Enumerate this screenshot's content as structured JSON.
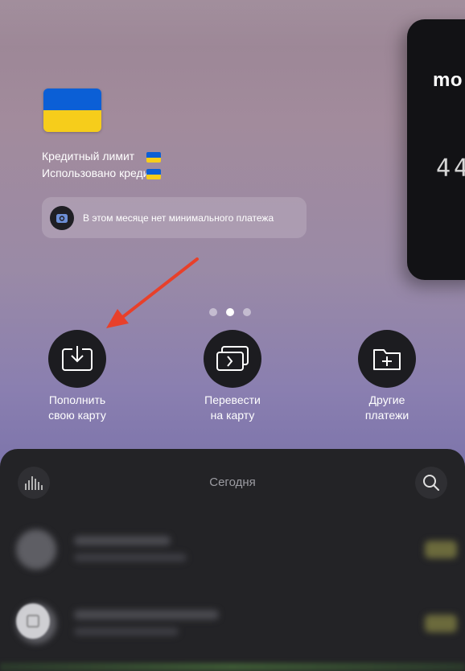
{
  "credit": {
    "limit_label": "Кредитный лимит",
    "used_label": "Использовано кредита"
  },
  "notice": {
    "text": "В этом месяце нет минимального платежа",
    "icon": "camera-icon"
  },
  "card": {
    "brand": "mo",
    "digits": "44"
  },
  "pager": {
    "count": 3,
    "active_index": 1
  },
  "actions": [
    {
      "line1": "Пополнить",
      "line2": "свою карту",
      "icon": "download-tray-icon"
    },
    {
      "line1": "Перевести",
      "line2": "на карту",
      "icon": "card-transfer-icon"
    },
    {
      "line1": "Другие",
      "line2": "платежи",
      "icon": "folder-add-icon"
    }
  ],
  "sheet": {
    "title": "Сегодня",
    "left_icon": "chart-bars-icon",
    "right_icon": "search-icon"
  },
  "colors": {
    "flag_blue": "#0b5fd6",
    "flag_yellow": "#f6cd1b",
    "arrow": "#e8402a",
    "sheet_bg": "#232326"
  }
}
